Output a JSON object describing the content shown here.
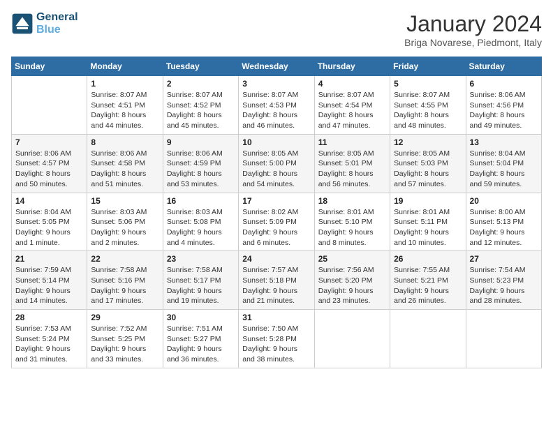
{
  "header": {
    "logo_line1": "General",
    "logo_line2": "Blue",
    "month_title": "January 2024",
    "location": "Briga Novarese, Piedmont, Italy"
  },
  "weekdays": [
    "Sunday",
    "Monday",
    "Tuesday",
    "Wednesday",
    "Thursday",
    "Friday",
    "Saturday"
  ],
  "weeks": [
    [
      {
        "day": "",
        "sunrise": "",
        "sunset": "",
        "daylight": ""
      },
      {
        "day": "1",
        "sunrise": "Sunrise: 8:07 AM",
        "sunset": "Sunset: 4:51 PM",
        "daylight": "Daylight: 8 hours and 44 minutes."
      },
      {
        "day": "2",
        "sunrise": "Sunrise: 8:07 AM",
        "sunset": "Sunset: 4:52 PM",
        "daylight": "Daylight: 8 hours and 45 minutes."
      },
      {
        "day": "3",
        "sunrise": "Sunrise: 8:07 AM",
        "sunset": "Sunset: 4:53 PM",
        "daylight": "Daylight: 8 hours and 46 minutes."
      },
      {
        "day": "4",
        "sunrise": "Sunrise: 8:07 AM",
        "sunset": "Sunset: 4:54 PM",
        "daylight": "Daylight: 8 hours and 47 minutes."
      },
      {
        "day": "5",
        "sunrise": "Sunrise: 8:07 AM",
        "sunset": "Sunset: 4:55 PM",
        "daylight": "Daylight: 8 hours and 48 minutes."
      },
      {
        "day": "6",
        "sunrise": "Sunrise: 8:06 AM",
        "sunset": "Sunset: 4:56 PM",
        "daylight": "Daylight: 8 hours and 49 minutes."
      }
    ],
    [
      {
        "day": "7",
        "sunrise": "Sunrise: 8:06 AM",
        "sunset": "Sunset: 4:57 PM",
        "daylight": "Daylight: 8 hours and 50 minutes."
      },
      {
        "day": "8",
        "sunrise": "Sunrise: 8:06 AM",
        "sunset": "Sunset: 4:58 PM",
        "daylight": "Daylight: 8 hours and 51 minutes."
      },
      {
        "day": "9",
        "sunrise": "Sunrise: 8:06 AM",
        "sunset": "Sunset: 4:59 PM",
        "daylight": "Daylight: 8 hours and 53 minutes."
      },
      {
        "day": "10",
        "sunrise": "Sunrise: 8:05 AM",
        "sunset": "Sunset: 5:00 PM",
        "daylight": "Daylight: 8 hours and 54 minutes."
      },
      {
        "day": "11",
        "sunrise": "Sunrise: 8:05 AM",
        "sunset": "Sunset: 5:01 PM",
        "daylight": "Daylight: 8 hours and 56 minutes."
      },
      {
        "day": "12",
        "sunrise": "Sunrise: 8:05 AM",
        "sunset": "Sunset: 5:03 PM",
        "daylight": "Daylight: 8 hours and 57 minutes."
      },
      {
        "day": "13",
        "sunrise": "Sunrise: 8:04 AM",
        "sunset": "Sunset: 5:04 PM",
        "daylight": "Daylight: 8 hours and 59 minutes."
      }
    ],
    [
      {
        "day": "14",
        "sunrise": "Sunrise: 8:04 AM",
        "sunset": "Sunset: 5:05 PM",
        "daylight": "Daylight: 9 hours and 1 minute."
      },
      {
        "day": "15",
        "sunrise": "Sunrise: 8:03 AM",
        "sunset": "Sunset: 5:06 PM",
        "daylight": "Daylight: 9 hours and 2 minutes."
      },
      {
        "day": "16",
        "sunrise": "Sunrise: 8:03 AM",
        "sunset": "Sunset: 5:08 PM",
        "daylight": "Daylight: 9 hours and 4 minutes."
      },
      {
        "day": "17",
        "sunrise": "Sunrise: 8:02 AM",
        "sunset": "Sunset: 5:09 PM",
        "daylight": "Daylight: 9 hours and 6 minutes."
      },
      {
        "day": "18",
        "sunrise": "Sunrise: 8:01 AM",
        "sunset": "Sunset: 5:10 PM",
        "daylight": "Daylight: 9 hours and 8 minutes."
      },
      {
        "day": "19",
        "sunrise": "Sunrise: 8:01 AM",
        "sunset": "Sunset: 5:11 PM",
        "daylight": "Daylight: 9 hours and 10 minutes."
      },
      {
        "day": "20",
        "sunrise": "Sunrise: 8:00 AM",
        "sunset": "Sunset: 5:13 PM",
        "daylight": "Daylight: 9 hours and 12 minutes."
      }
    ],
    [
      {
        "day": "21",
        "sunrise": "Sunrise: 7:59 AM",
        "sunset": "Sunset: 5:14 PM",
        "daylight": "Daylight: 9 hours and 14 minutes."
      },
      {
        "day": "22",
        "sunrise": "Sunrise: 7:58 AM",
        "sunset": "Sunset: 5:16 PM",
        "daylight": "Daylight: 9 hours and 17 minutes."
      },
      {
        "day": "23",
        "sunrise": "Sunrise: 7:58 AM",
        "sunset": "Sunset: 5:17 PM",
        "daylight": "Daylight: 9 hours and 19 minutes."
      },
      {
        "day": "24",
        "sunrise": "Sunrise: 7:57 AM",
        "sunset": "Sunset: 5:18 PM",
        "daylight": "Daylight: 9 hours and 21 minutes."
      },
      {
        "day": "25",
        "sunrise": "Sunrise: 7:56 AM",
        "sunset": "Sunset: 5:20 PM",
        "daylight": "Daylight: 9 hours and 23 minutes."
      },
      {
        "day": "26",
        "sunrise": "Sunrise: 7:55 AM",
        "sunset": "Sunset: 5:21 PM",
        "daylight": "Daylight: 9 hours and 26 minutes."
      },
      {
        "day": "27",
        "sunrise": "Sunrise: 7:54 AM",
        "sunset": "Sunset: 5:23 PM",
        "daylight": "Daylight: 9 hours and 28 minutes."
      }
    ],
    [
      {
        "day": "28",
        "sunrise": "Sunrise: 7:53 AM",
        "sunset": "Sunset: 5:24 PM",
        "daylight": "Daylight: 9 hours and 31 minutes."
      },
      {
        "day": "29",
        "sunrise": "Sunrise: 7:52 AM",
        "sunset": "Sunset: 5:25 PM",
        "daylight": "Daylight: 9 hours and 33 minutes."
      },
      {
        "day": "30",
        "sunrise": "Sunrise: 7:51 AM",
        "sunset": "Sunset: 5:27 PM",
        "daylight": "Daylight: 9 hours and 36 minutes."
      },
      {
        "day": "31",
        "sunrise": "Sunrise: 7:50 AM",
        "sunset": "Sunset: 5:28 PM",
        "daylight": "Daylight: 9 hours and 38 minutes."
      },
      {
        "day": "",
        "sunrise": "",
        "sunset": "",
        "daylight": ""
      },
      {
        "day": "",
        "sunrise": "",
        "sunset": "",
        "daylight": ""
      },
      {
        "day": "",
        "sunrise": "",
        "sunset": "",
        "daylight": ""
      }
    ]
  ]
}
